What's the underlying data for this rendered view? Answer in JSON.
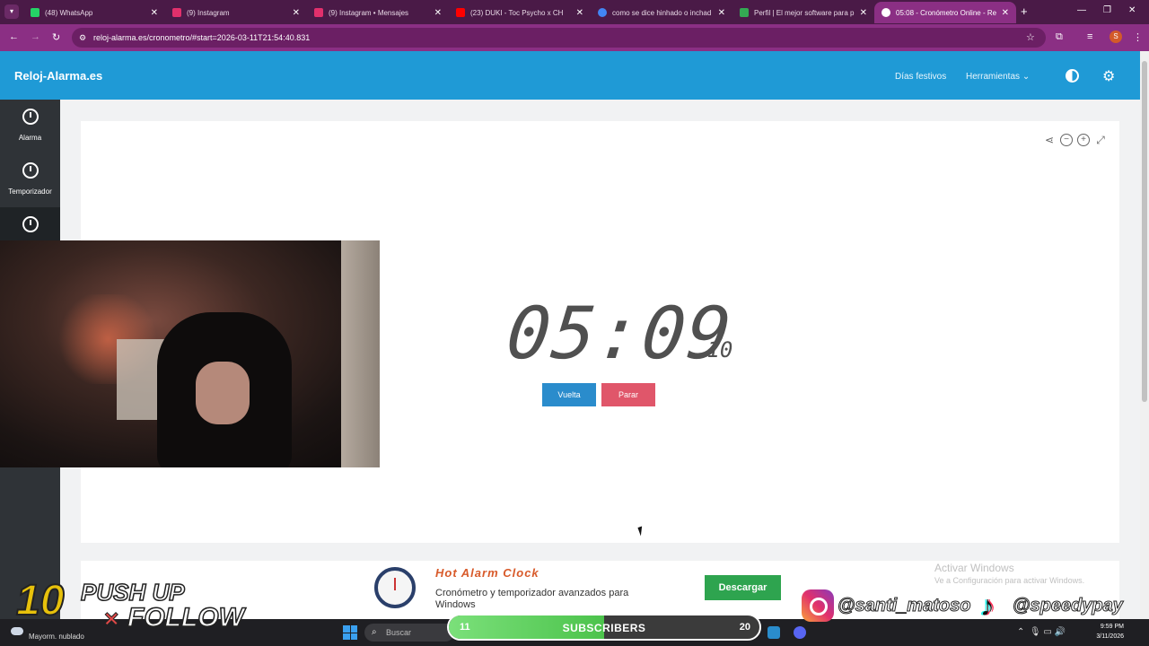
{
  "browser": {
    "tabs": [
      {
        "title": "(48) WhatsApp",
        "color": "#25d366"
      },
      {
        "title": "(9) Instagram",
        "color": "#e1306c"
      },
      {
        "title": "(9) Instagram • Mensajes",
        "color": "#e1306c"
      },
      {
        "title": "(23) DUKI - Toc Psycho x CH",
        "color": "#ff0000"
      },
      {
        "title": "como se dice hinhado o inchad",
        "color": "#4285f4"
      },
      {
        "title": "Perfil | El mejor software para p",
        "color": "#34a853"
      },
      {
        "title": "05:08 - Cronómetro Online - Re",
        "color": "#ffffff"
      }
    ],
    "url": "reloj-alarma.es/cronometro/#start=2026-03-11T21:54:40.831",
    "profile_initial": "S"
  },
  "site": {
    "logo": "Reloj-Alarma.es",
    "nav": {
      "dias": "Días festivos",
      "herramientas": "Herramientas"
    }
  },
  "sidebar": {
    "items": [
      {
        "label": "Alarma",
        "icon": "alarm-clock-icon"
      },
      {
        "label": "Temporizador",
        "icon": "timer-icon"
      },
      {
        "label": "",
        "icon": "stopwatch-icon"
      }
    ]
  },
  "stopwatch": {
    "time": "05:09",
    "ms": "10",
    "vuelta_label": "Vuelta",
    "parar_label": "Parar"
  },
  "ad": {
    "title": "Hot Alarm Clock",
    "description": "Cronómetro y temporizador avanzados para Windows",
    "button": "Descargar"
  },
  "watermark": {
    "line1": "Activar Windows",
    "line2": "Ve a Configuración para activar Windows."
  },
  "overlay": {
    "pushup_number": "10",
    "pushup_line1": "PUSH UP",
    "pushup_x": "×",
    "pushup_line2": "FOLLOW",
    "instagram": "@santi_matoso",
    "tiktok": "@speedypay",
    "subs_start": "11",
    "subs_label": "SUBSCRIBERS",
    "subs_goal": "20",
    "subs_progress": 0.5
  },
  "taskbar": {
    "weather": "Mayorm. nublado",
    "search_placeholder": "Buscar",
    "time": "9:59 PM",
    "date": "3/11/2026"
  },
  "colors": {
    "header": "#1f9ad6",
    "browser": "#8b2f84",
    "vuelta": "#2a8ccc",
    "parar": "#e0566a"
  }
}
